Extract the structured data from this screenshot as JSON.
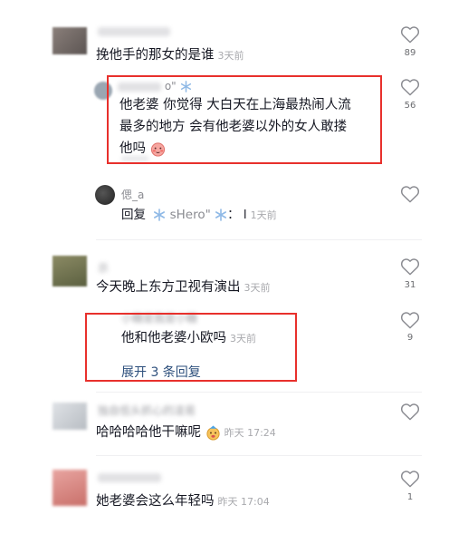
{
  "comments": [
    {
      "id": "c1",
      "text": "挽他手的那女的是谁",
      "time": "3天前",
      "likes": "89"
    },
    {
      "id": "r1",
      "username_tail": "o\"",
      "text_lines": [
        "他老婆 你觉得 大白天在上海最热闹人流",
        "最多的地方 会有他老婆以外的女人敢搂",
        "他吗"
      ],
      "likes": "56"
    },
    {
      "id": "r2",
      "username": "偲_a",
      "reply_label": "回复",
      "mention": "sHero\"",
      "mention_suffix": "：",
      "text": "l",
      "time": "1天前"
    },
    {
      "id": "c2",
      "username_tail": "示",
      "text": "今天晚上东方卫视有演出",
      "time": "3天前",
      "likes": "31"
    },
    {
      "id": "r3",
      "username": "小糖是我是小糖",
      "text": "他和他老婆小欧吗",
      "time": "3天前",
      "likes": "9",
      "expand_label": "展开 3 条回复"
    },
    {
      "id": "c3",
      "username": "独自低头抓心的凌易",
      "text": "哈哈哈哈他干嘛呢",
      "time": "昨天 17:24"
    },
    {
      "id": "c4",
      "text": "她老婆会这么年轻吗",
      "time": "昨天 17:04",
      "likes": "1"
    }
  ],
  "colors": {
    "highlight_border": "#e8302c",
    "link": "#2d4f7c",
    "muted": "#a8a9ad"
  },
  "icons": {
    "like": "heart-outline-icon",
    "badge": "snowflake-badge-icon",
    "emoji": "blushing-face-emoji"
  }
}
